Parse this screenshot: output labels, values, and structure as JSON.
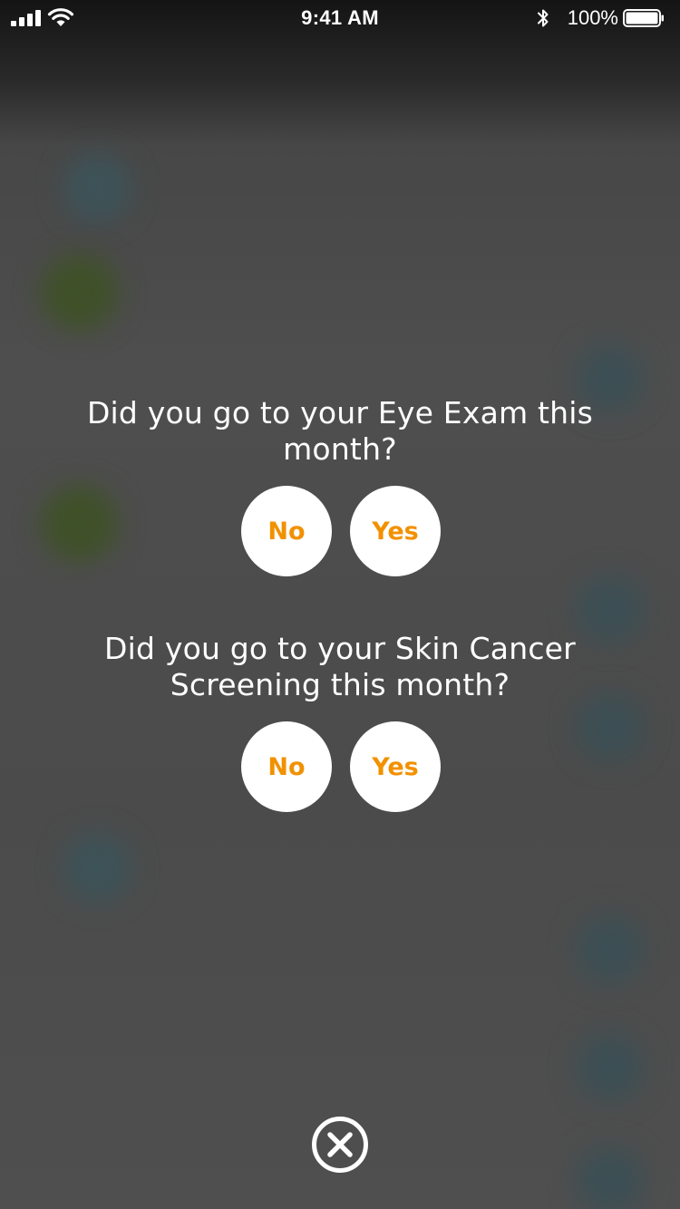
{
  "status_bar": {
    "time": "9:41 AM",
    "battery_percent": "100%",
    "signal_icon": "cellular-signal-icon",
    "wifi_icon": "wifi-icon",
    "bluetooth_icon": "bluetooth-icon",
    "battery_icon": "battery-icon"
  },
  "questions": [
    {
      "text": "Did you go to your Eye Exam this month?",
      "no_label": "No",
      "yes_label": "Yes"
    },
    {
      "text": "Did you go to your Skin Cancer Screening this month?",
      "no_label": "No",
      "yes_label": "Yes"
    }
  ],
  "close_icon": "close-circle-icon",
  "colors": {
    "accent": "#f29100",
    "overlay": "#4d4d4d",
    "button_bg": "#ffffff",
    "text": "#ffffff"
  }
}
